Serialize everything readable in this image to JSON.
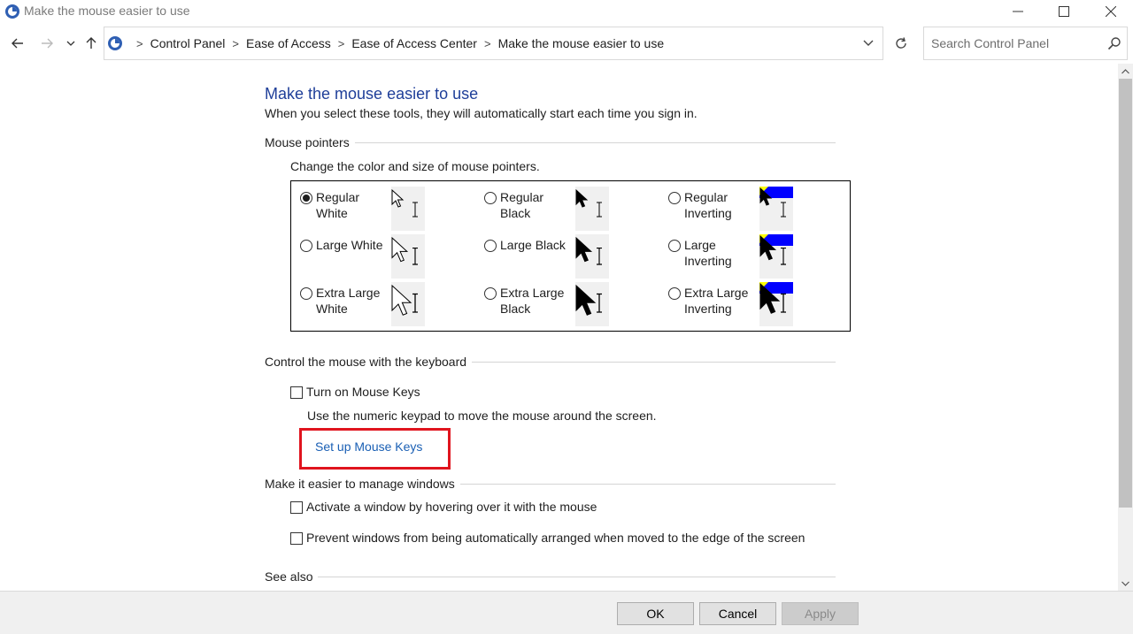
{
  "window": {
    "title": "Make the mouse easier to use"
  },
  "address": {
    "crumbs": [
      "Control Panel",
      "Ease of Access",
      "Ease of Access Center",
      "Make the mouse easier to use"
    ],
    "search_placeholder": "Search Control Panel"
  },
  "page": {
    "title": "Make the mouse easier to use",
    "subtitle": "When you select these tools, they will automatically start each time you sign in."
  },
  "mouse_pointers": {
    "heading": "Mouse pointers",
    "intro": "Change the color and size of mouse pointers.",
    "options": [
      {
        "label": "Regular White",
        "selected": true,
        "scheme": "white",
        "size": "regular"
      },
      {
        "label": "Regular Black",
        "selected": false,
        "scheme": "black",
        "size": "regular"
      },
      {
        "label": "Regular Inverting",
        "selected": false,
        "scheme": "inverting",
        "size": "regular"
      },
      {
        "label": "Large White",
        "selected": false,
        "scheme": "white",
        "size": "large"
      },
      {
        "label": "Large Black",
        "selected": false,
        "scheme": "black",
        "size": "large"
      },
      {
        "label": "Large Inverting",
        "selected": false,
        "scheme": "inverting",
        "size": "large"
      },
      {
        "label": "Extra Large White",
        "selected": false,
        "scheme": "white",
        "size": "extra-large"
      },
      {
        "label": "Extra Large Black",
        "selected": false,
        "scheme": "black",
        "size": "extra-large"
      },
      {
        "label": "Extra Large Inverting",
        "selected": false,
        "scheme": "inverting",
        "size": "extra-large"
      }
    ]
  },
  "keyboard": {
    "heading": "Control the mouse with the keyboard",
    "mouse_keys_label": "Turn on Mouse Keys",
    "mouse_keys_checked": false,
    "mouse_keys_desc": "Use the numeric keypad to move the mouse around the screen.",
    "setup_link": "Set up Mouse Keys"
  },
  "windows": {
    "heading": "Make it easier to manage windows",
    "hover_label": "Activate a window by hovering over it with the mouse",
    "hover_checked": false,
    "snap_label": "Prevent windows from being automatically arranged when moved to the edge of the screen",
    "snap_checked": false
  },
  "see_also": {
    "heading": "See also"
  },
  "footer": {
    "ok": "OK",
    "cancel": "Cancel",
    "apply": "Apply"
  },
  "colors": {
    "title_blue": "#1f3f99",
    "link_blue": "#1a5fb4",
    "highlight_red": "#e0141e",
    "invert_blue": "#0000ff",
    "invert_yellow": "#ffff00"
  }
}
